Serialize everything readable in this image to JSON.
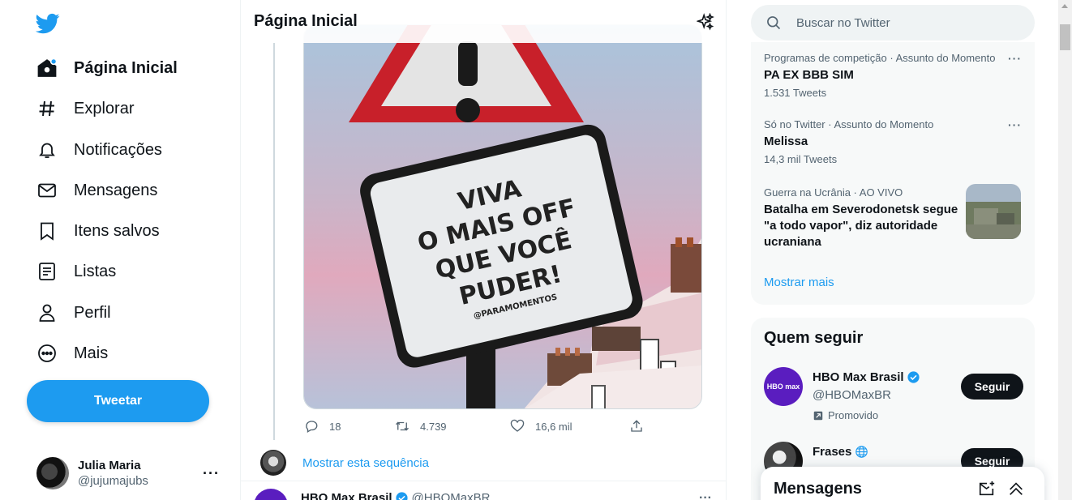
{
  "nav": {
    "items": [
      {
        "label": "Página Inicial",
        "icon": "home-icon"
      },
      {
        "label": "Explorar",
        "icon": "hashtag-icon"
      },
      {
        "label": "Notificações",
        "icon": "bell-icon"
      },
      {
        "label": "Mensagens",
        "icon": "envelope-icon"
      },
      {
        "label": "Itens salvos",
        "icon": "bookmark-icon"
      },
      {
        "label": "Listas",
        "icon": "list-icon"
      },
      {
        "label": "Perfil",
        "icon": "person-icon"
      },
      {
        "label": "Mais",
        "icon": "more-circle-icon"
      }
    ],
    "tweet_button": "Tweetar",
    "account": {
      "name": "Julia Maria",
      "handle": "@jujumajubs"
    }
  },
  "header": {
    "title": "Página Inicial"
  },
  "tweet": {
    "image_text": {
      "line1": "VIVA",
      "line2": "O MAIS OFF",
      "line3": "QUE VOCÊ",
      "line4": "PUDER!",
      "credit": "@PARAMOMENTOS"
    },
    "replies": "18",
    "retweets": "4.739",
    "likes": "16,6 mil",
    "show_thread": "Mostrar esta sequência"
  },
  "next_tweet": {
    "name": "HBO Max Brasil",
    "handle": "@HBOMaxBR"
  },
  "search": {
    "placeholder": "Buscar no Twitter"
  },
  "trends": {
    "items": [
      {
        "meta": "Programas de competição · Assunto do Momento",
        "title": "PA EX BBB SIM",
        "count": "1.531 Tweets"
      },
      {
        "meta": "Só no Twitter · Assunto do Momento",
        "title": "Melissa",
        "count": "14,3 mil Tweets"
      },
      {
        "meta": "Guerra na Ucrânia · AO VIVO",
        "title": "Batalha em Severodonetsk segue \"a todo vapor\", diz autoridade ucraniana"
      }
    ],
    "show_more": "Mostrar mais"
  },
  "who_to_follow": {
    "title": "Quem seguir",
    "accounts": [
      {
        "name": "HBO Max Brasil",
        "handle": "@HBOMaxBR",
        "promoted": "Promovido",
        "button": "Seguir",
        "avatar_text": "HBO max"
      },
      {
        "name": "Frases",
        "button": "Seguir"
      }
    ]
  },
  "messages_drawer": {
    "title": "Mensagens"
  },
  "colors": {
    "accent": "#1d9bf0",
    "text": "#0f1419",
    "secondary": "#536471",
    "panel": "#f7f9f9"
  }
}
